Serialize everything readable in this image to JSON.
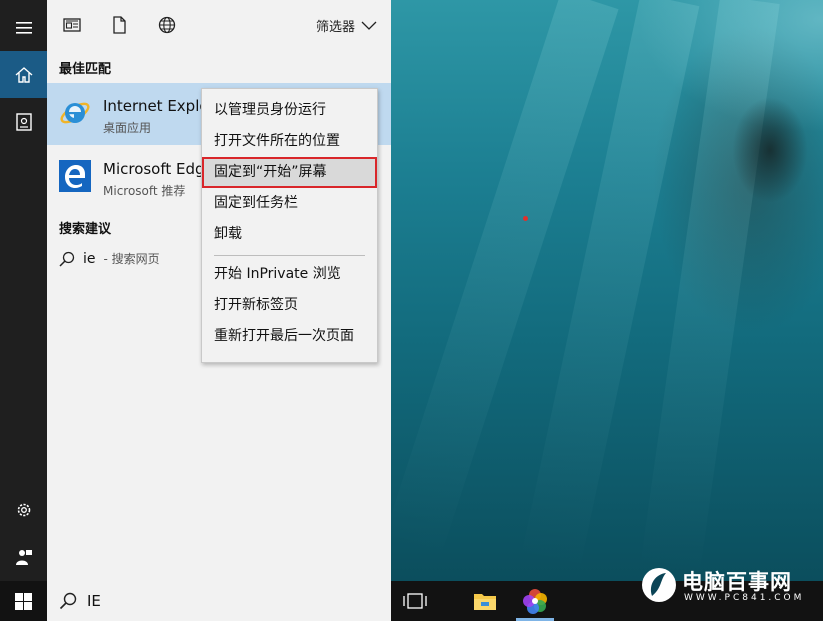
{
  "start_menu": {
    "filter_label": "筛选器",
    "best_match_title": "最佳匹配",
    "results": [
      {
        "name": "Internet Explo",
        "subtitle": "桌面应用",
        "icon": "internet-explorer-icon"
      },
      {
        "name": "Microsoft Edg",
        "subtitle": "Microsoft 推荐",
        "icon": "microsoft-edge-icon"
      }
    ],
    "suggestions_title": "搜索建议",
    "suggestion": {
      "query": "ie",
      "hint": "- 搜索网页"
    }
  },
  "context_menu": {
    "items": [
      "以管理员身份运行",
      "打开文件所在的位置",
      "固定到“开始”屏幕",
      "固定到任务栏",
      "卸载",
      "开始 InPrivate 浏览",
      "打开新标签页",
      "重新打开最后一次页面"
    ],
    "highlighted_index": 2
  },
  "taskbar": {
    "search_value": "IE"
  },
  "watermark": {
    "brand": "电脑百事网",
    "url": "WWW.PC841.COM"
  },
  "colors": {
    "accent": "#1b5b86",
    "selection": "#bfd9ef",
    "highlight_border": "#d9262a"
  }
}
